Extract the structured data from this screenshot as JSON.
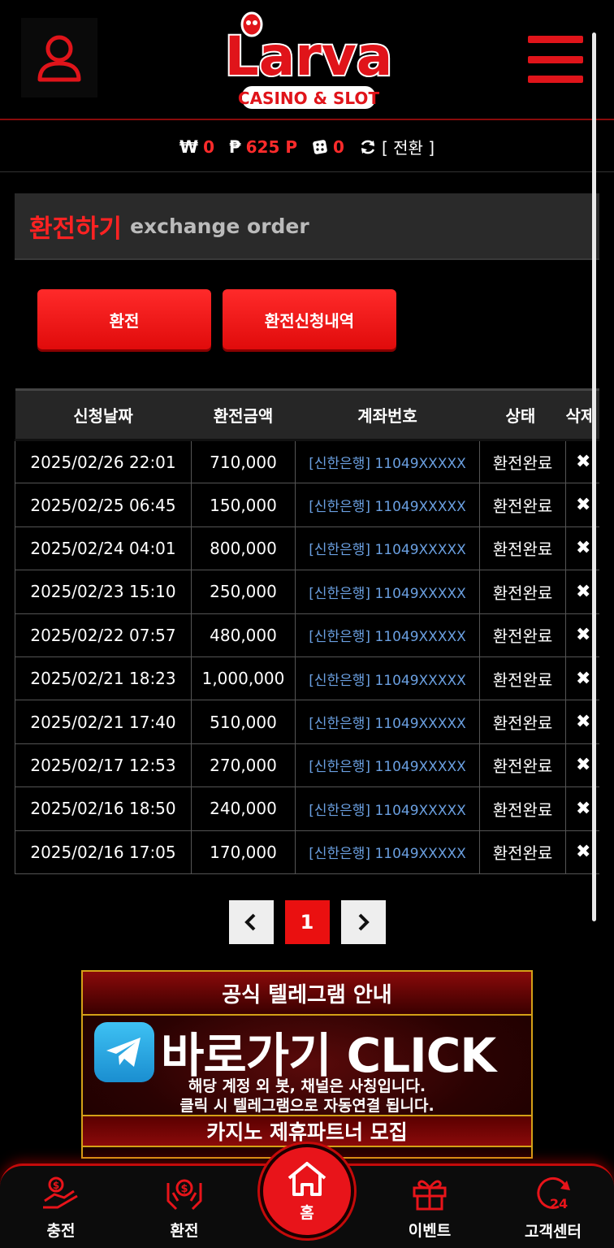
{
  "header": {
    "logo_text": "Larva",
    "logo_sub": "CASINO & SLOT"
  },
  "balance": {
    "won_symbol": "₩",
    "won_value": "0",
    "point_symbol": "₱",
    "point_value": "625 P",
    "chip_value": "0",
    "switch_label": "[ 전환 ]"
  },
  "page_title": {
    "ko": "환전하기",
    "en": "exchange order"
  },
  "buttons": {
    "exchange": "환전",
    "history": "환전신청내역"
  },
  "table": {
    "headers": [
      "신청날짜",
      "환전금액",
      "계좌번호",
      "상태",
      "삭제"
    ],
    "rows": [
      {
        "date": "2025/02/26 22:01",
        "amount": "710,000",
        "account": "[신한은행] 11049XXXXX",
        "status": "환전완료",
        "del": "✖"
      },
      {
        "date": "2025/02/25 06:45",
        "amount": "150,000",
        "account": "[신한은행] 11049XXXXX",
        "status": "환전완료",
        "del": "✖"
      },
      {
        "date": "2025/02/24 04:01",
        "amount": "800,000",
        "account": "[신한은행] 11049XXXXX",
        "status": "환전완료",
        "del": "✖"
      },
      {
        "date": "2025/02/23 15:10",
        "amount": "250,000",
        "account": "[신한은행] 11049XXXXX",
        "status": "환전완료",
        "del": "✖"
      },
      {
        "date": "2025/02/22 07:57",
        "amount": "480,000",
        "account": "[신한은행] 11049XXXXX",
        "status": "환전완료",
        "del": "✖"
      },
      {
        "date": "2025/02/21 18:23",
        "amount": "1,000,000",
        "account": "[신한은행] 11049XXXXX",
        "status": "환전완료",
        "del": "✖"
      },
      {
        "date": "2025/02/21 17:40",
        "amount": "510,000",
        "account": "[신한은행] 11049XXXXX",
        "status": "환전완료",
        "del": "✖"
      },
      {
        "date": "2025/02/17 12:53",
        "amount": "270,000",
        "account": "[신한은행] 11049XXXXX",
        "status": "환전완료",
        "del": "✖"
      },
      {
        "date": "2025/02/16 18:50",
        "amount": "240,000",
        "account": "[신한은행] 11049XXXXX",
        "status": "환전완료",
        "del": "✖"
      },
      {
        "date": "2025/02/16 17:05",
        "amount": "170,000",
        "account": "[신한은행] 11049XXXXX",
        "status": "환전완료",
        "del": "✖"
      }
    ]
  },
  "pagination": {
    "prev": "‹",
    "current": "1",
    "next": "›"
  },
  "banner": {
    "top": "공식 텔레그램 안내",
    "main": "바로가기 CLICK",
    "sub1": "해당 계정 외 봇, 채널은 사칭입니다.",
    "sub2": "클릭 시 텔레그램으로 자동연결 됩니다.",
    "bottom": "카지노 제휴파트너 모집"
  },
  "bottom_nav": {
    "deposit": "충전",
    "withdraw": "환전",
    "home": "홈",
    "event": "이벤트",
    "support": "고객센터"
  },
  "colors": {
    "accent": "#e8141a",
    "account_link": "#6a9fe0"
  }
}
